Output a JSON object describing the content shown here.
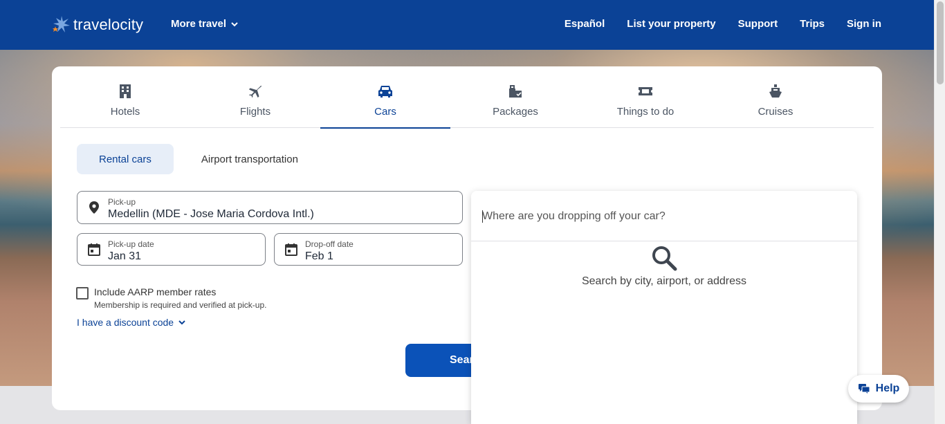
{
  "brand": {
    "name": "travelocity"
  },
  "header": {
    "more_travel": "More travel",
    "links": [
      "Español",
      "List your property",
      "Support",
      "Trips",
      "Sign in"
    ]
  },
  "tabs": [
    {
      "label": "Hotels",
      "icon": "hotel-icon"
    },
    {
      "label": "Flights",
      "icon": "plane-icon"
    },
    {
      "label": "Cars",
      "icon": "car-icon",
      "active": true
    },
    {
      "label": "Packages",
      "icon": "packages-icon"
    },
    {
      "label": "Things to do",
      "icon": "ticket-icon"
    },
    {
      "label": "Cruises",
      "icon": "cruise-icon"
    }
  ],
  "subtabs": {
    "rental": "Rental cars",
    "airport": "Airport transportation"
  },
  "pickup": {
    "label": "Pick-up",
    "value": "Medellin (MDE - Jose Maria Cordova Intl.)"
  },
  "pickup_date": {
    "label": "Pick-up date",
    "value": "Jan 31"
  },
  "dropoff_date": {
    "label": "Drop-off date",
    "value": "Feb 1"
  },
  "aarp": {
    "title": "Include AARP member rates",
    "note": "Membership is required and verified at pick-up.",
    "checked": false
  },
  "discount": {
    "label": "I have a discount code"
  },
  "search_button": {
    "label": "Sear"
  },
  "dropoff_panel": {
    "placeholder": "Where are you dropping off your car?",
    "hint": "Search by city, airport, or address"
  },
  "help": {
    "label": "Help"
  },
  "colors": {
    "brand_blue": "#0b4296",
    "button_blue": "#0b52b8",
    "subtab_bg": "#e7eef8"
  }
}
